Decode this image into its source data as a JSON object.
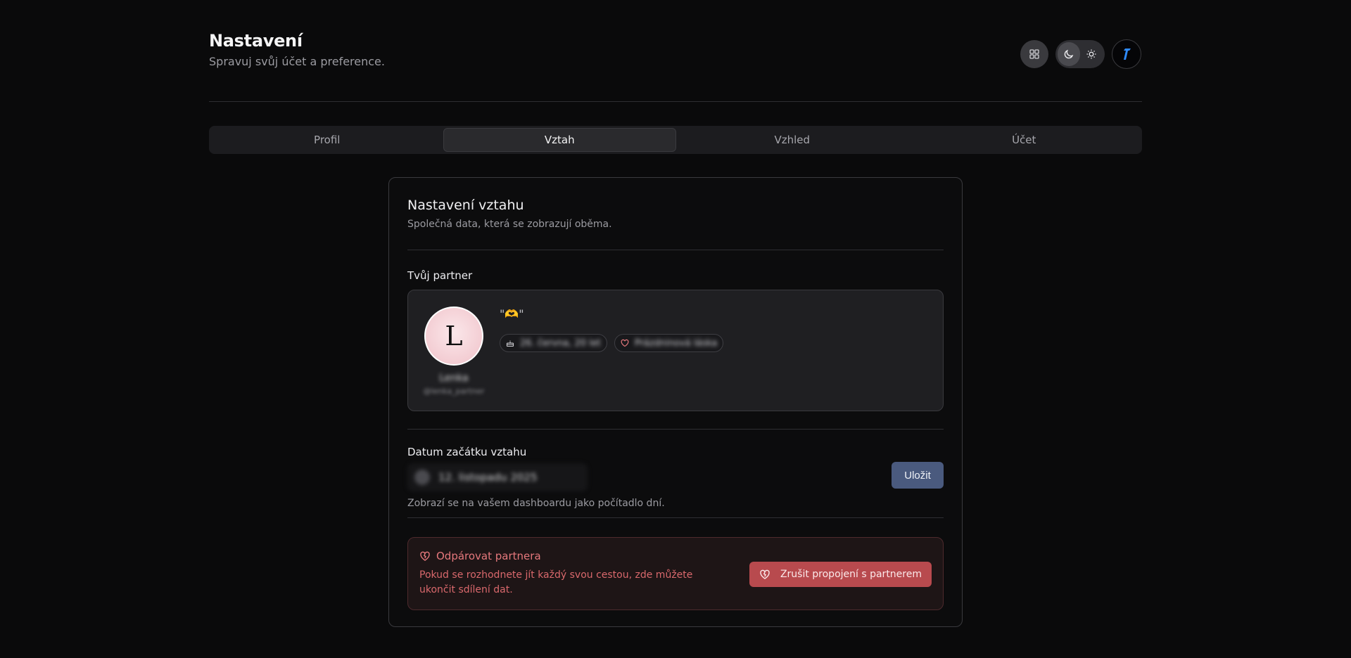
{
  "header": {
    "title": "Nastavení",
    "subtitle": "Spravuj svůj účet a preference."
  },
  "top_controls": {
    "icons": [
      "grid-icon",
      "moon-icon",
      "sun-icon",
      "user-avatar"
    ],
    "theme_active": "dark"
  },
  "tabs": [
    {
      "label": "Profil",
      "active": false
    },
    {
      "label": "Vztah",
      "active": true
    },
    {
      "label": "Vzhled",
      "active": false
    },
    {
      "label": "Účet",
      "active": false
    }
  ],
  "card": {
    "title": "Nastavení vztahu",
    "description": "Společná data, která se zobrazují oběma."
  },
  "partner": {
    "section_label": "Tvůj partner",
    "avatar_letter": "L",
    "name": "Lenka",
    "handle": "@lenka_partner",
    "quote": "\"🫶\"",
    "birthday": "26. června, 20 let",
    "status": "Prázdninová láska"
  },
  "relationship_date": {
    "label": "Datum začátku vztahu",
    "value": "12. listopadu 2025",
    "help": "Zobrazí se na vašem dashboardu jako počítadlo dní.",
    "save_label": "Uložit"
  },
  "unpair": {
    "title": "Odpárovat partnera",
    "text": "Pokud se rozhodnete jít každý svou cestou, zde můžete ukončit sdílení dat.",
    "button_label": "Zrušit propojení s partnerem"
  },
  "colors": {
    "background": "#0a0a0b",
    "accent_button": "#4a5a7e",
    "danger": "#b84a4e",
    "danger_text": "#e5787c"
  }
}
